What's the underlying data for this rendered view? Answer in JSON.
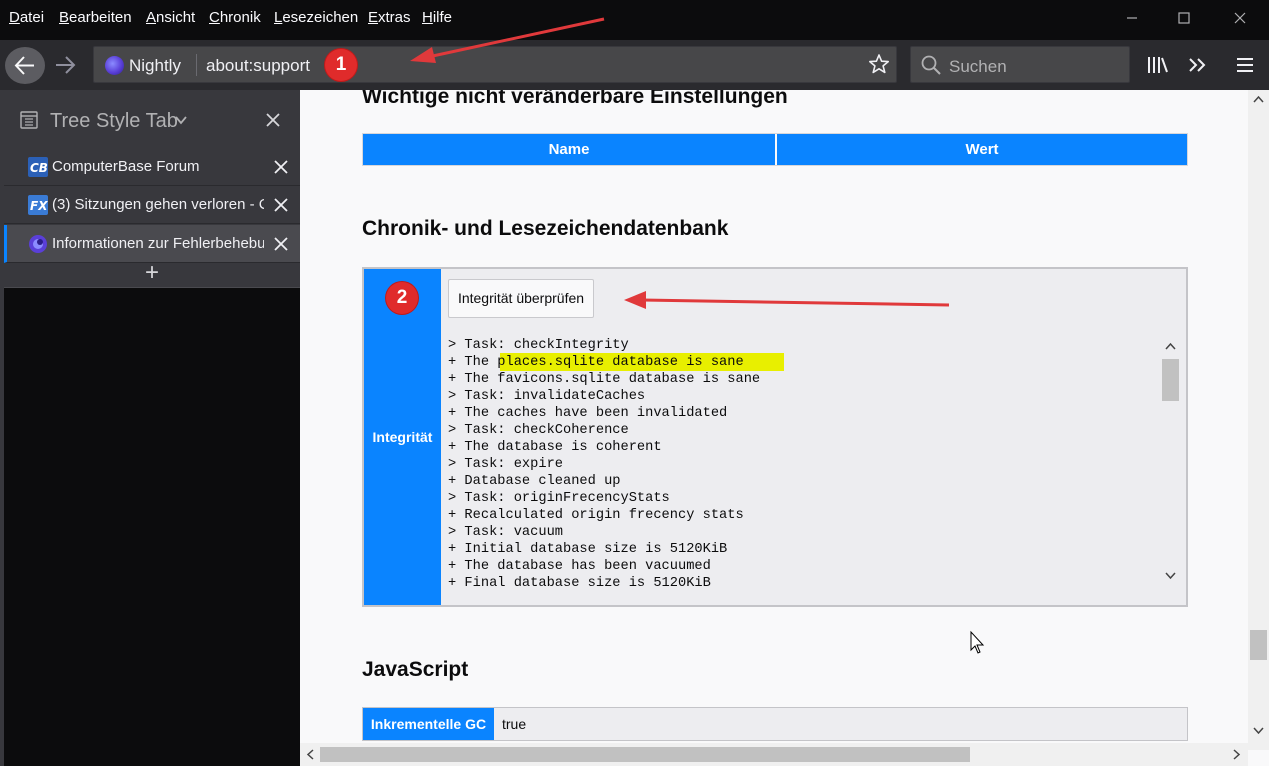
{
  "menubar": {
    "items": [
      "Datei",
      "Bearbeiten",
      "Ansicht",
      "Chronik",
      "Lesezeichen",
      "Extras",
      "Hilfe"
    ]
  },
  "urlbar": {
    "identity_label": "Nightly",
    "url": "about:support"
  },
  "searchbar": {
    "placeholder": "Suchen"
  },
  "sidebar": {
    "title": "Tree Style Tab",
    "tabs": [
      {
        "label": "ComputerBase Forum",
        "favicon": "computerbase-icon",
        "active": false
      },
      {
        "label": "(3) Sitzungen gehen verloren - C",
        "favicon": "firefox-forum-icon",
        "active": false
      },
      {
        "label": "Informationen zur Fehlerbehebu",
        "favicon": "nightly-icon",
        "active": true
      }
    ],
    "new_tab_label": "+"
  },
  "content": {
    "section_prefs_title": "Wichtige nicht veränderbare Einstellungen",
    "prefs_table": {
      "col_name": "Name",
      "col_value": "Wert"
    },
    "section_places_title": "Chronik- und Lesezeichendatenbank",
    "integrity": {
      "row_label": "Integrität",
      "button_label": "Integrität überprüfen",
      "log": [
        "> Task: checkIntegrity",
        "+ The places.sqlite database is sane",
        "+ The favicons.sqlite database is sane",
        "> Task: invalidateCaches",
        "+ The caches have been invalidated",
        "> Task: checkCoherence",
        "+ The database is coherent",
        "> Task: expire",
        "+ Database cleaned up",
        "> Task: originFrecencyStats",
        "+ Recalculated origin frecency stats",
        "> Task: vacuum",
        "+ Initial database size is 5120KiB",
        "+ The database has been vacuumed",
        "+ Final database size is 5120KiB"
      ]
    },
    "section_js_title": "JavaScript",
    "js_table": {
      "key": "Inkrementelle GC",
      "value": "true"
    }
  },
  "annotations": {
    "badge_1": "1",
    "badge_2": "2",
    "arrow_color": "#e0393b",
    "highlight_color": "#e8ef00"
  }
}
